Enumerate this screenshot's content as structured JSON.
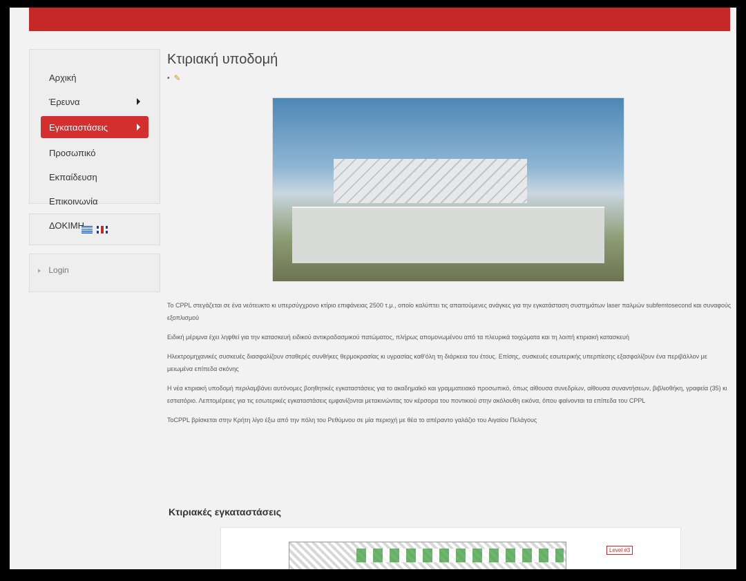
{
  "sidebar": {
    "items": [
      {
        "label": "Αρχική",
        "has_arrow": false,
        "active": false
      },
      {
        "label": "Έρευνα",
        "has_arrow": true,
        "active": false
      },
      {
        "label": "Εγκαταστάσεις",
        "has_arrow": true,
        "active": true
      },
      {
        "label": "Προσωπικό",
        "has_arrow": false,
        "active": false
      },
      {
        "label": "Εκπαίδευση",
        "has_arrow": false,
        "active": false
      },
      {
        "label": "Επικοινωνία",
        "has_arrow": false,
        "active": false
      },
      {
        "label": "ΔΟΚΙΜΗ",
        "has_arrow": false,
        "active": false
      }
    ],
    "login_label": "Login"
  },
  "content": {
    "title": "Κτιριακή υποδομή",
    "paragraphs": [
      "Το CPPL στεγάζεται σε ένα νεότευκτο κι υπερσύγχρονο κτίριο επιφάνειας 2500 τ.μ., οποίο καλύπτει τις απαιτούμενες ανάγκες για την εγκατάσταση συστημάτων laser παλμών subfemtosecond και συναφούς εξοπλισμού",
      "Ειδική μέριμνα έχει ληφθεί για την κατασκευή ειδικού αντικραδασμικού πατώματος, πλήρως απομονωμένου από τα πλευρικά τοιχώματα και τη λοιπή κτιριακή κατασκευή",
      "Ηλεκτρομηχανικές συσκευές διασφαλίζουν σταθερές συνθήκες θερμοκρασίας κι υγρασίας καθ'όλη τη διάρκεια του έτους. Επίσης, συσκευές εσωτερικής υπερπίεσης εξασφαλίζουν ένα περιβάλλον με μειωμένα επίπεδα σκόνης",
      "Η νέα κτιριακή υποδομή περιλαμβάνει αυτόνομες βοηθητικές εγκαταστάσεις για το ακαδημαϊκό και γραμματειακό προσωπικό, όπως αίθουσα συνεδρίων, αίθουσα συναντήσεων, βιβλιοθήκη, γραφεία (35) κι εστιατόριο. Λεπτομέρειες για τις εσωτερικές εγκαταστάσεις εμφανίζονται μετακινώντας τον κέρσορα του ποντικιού στην ακόλουθη εικόνα, όπου φαίνονται τα επίπεδα του CPPL",
      "ΤοCPPL βρίσκεται στην Κρήτη λίγο έξω από την πόλη του Ρεθύμνου σε μία περιοχή με θέα το απέραντο γαλάζιο του Αιγαίου Πελάγους"
    ],
    "section_title": "Κτιριακές εγκαταστάσεις",
    "plan_level_label": "Level #3"
  }
}
